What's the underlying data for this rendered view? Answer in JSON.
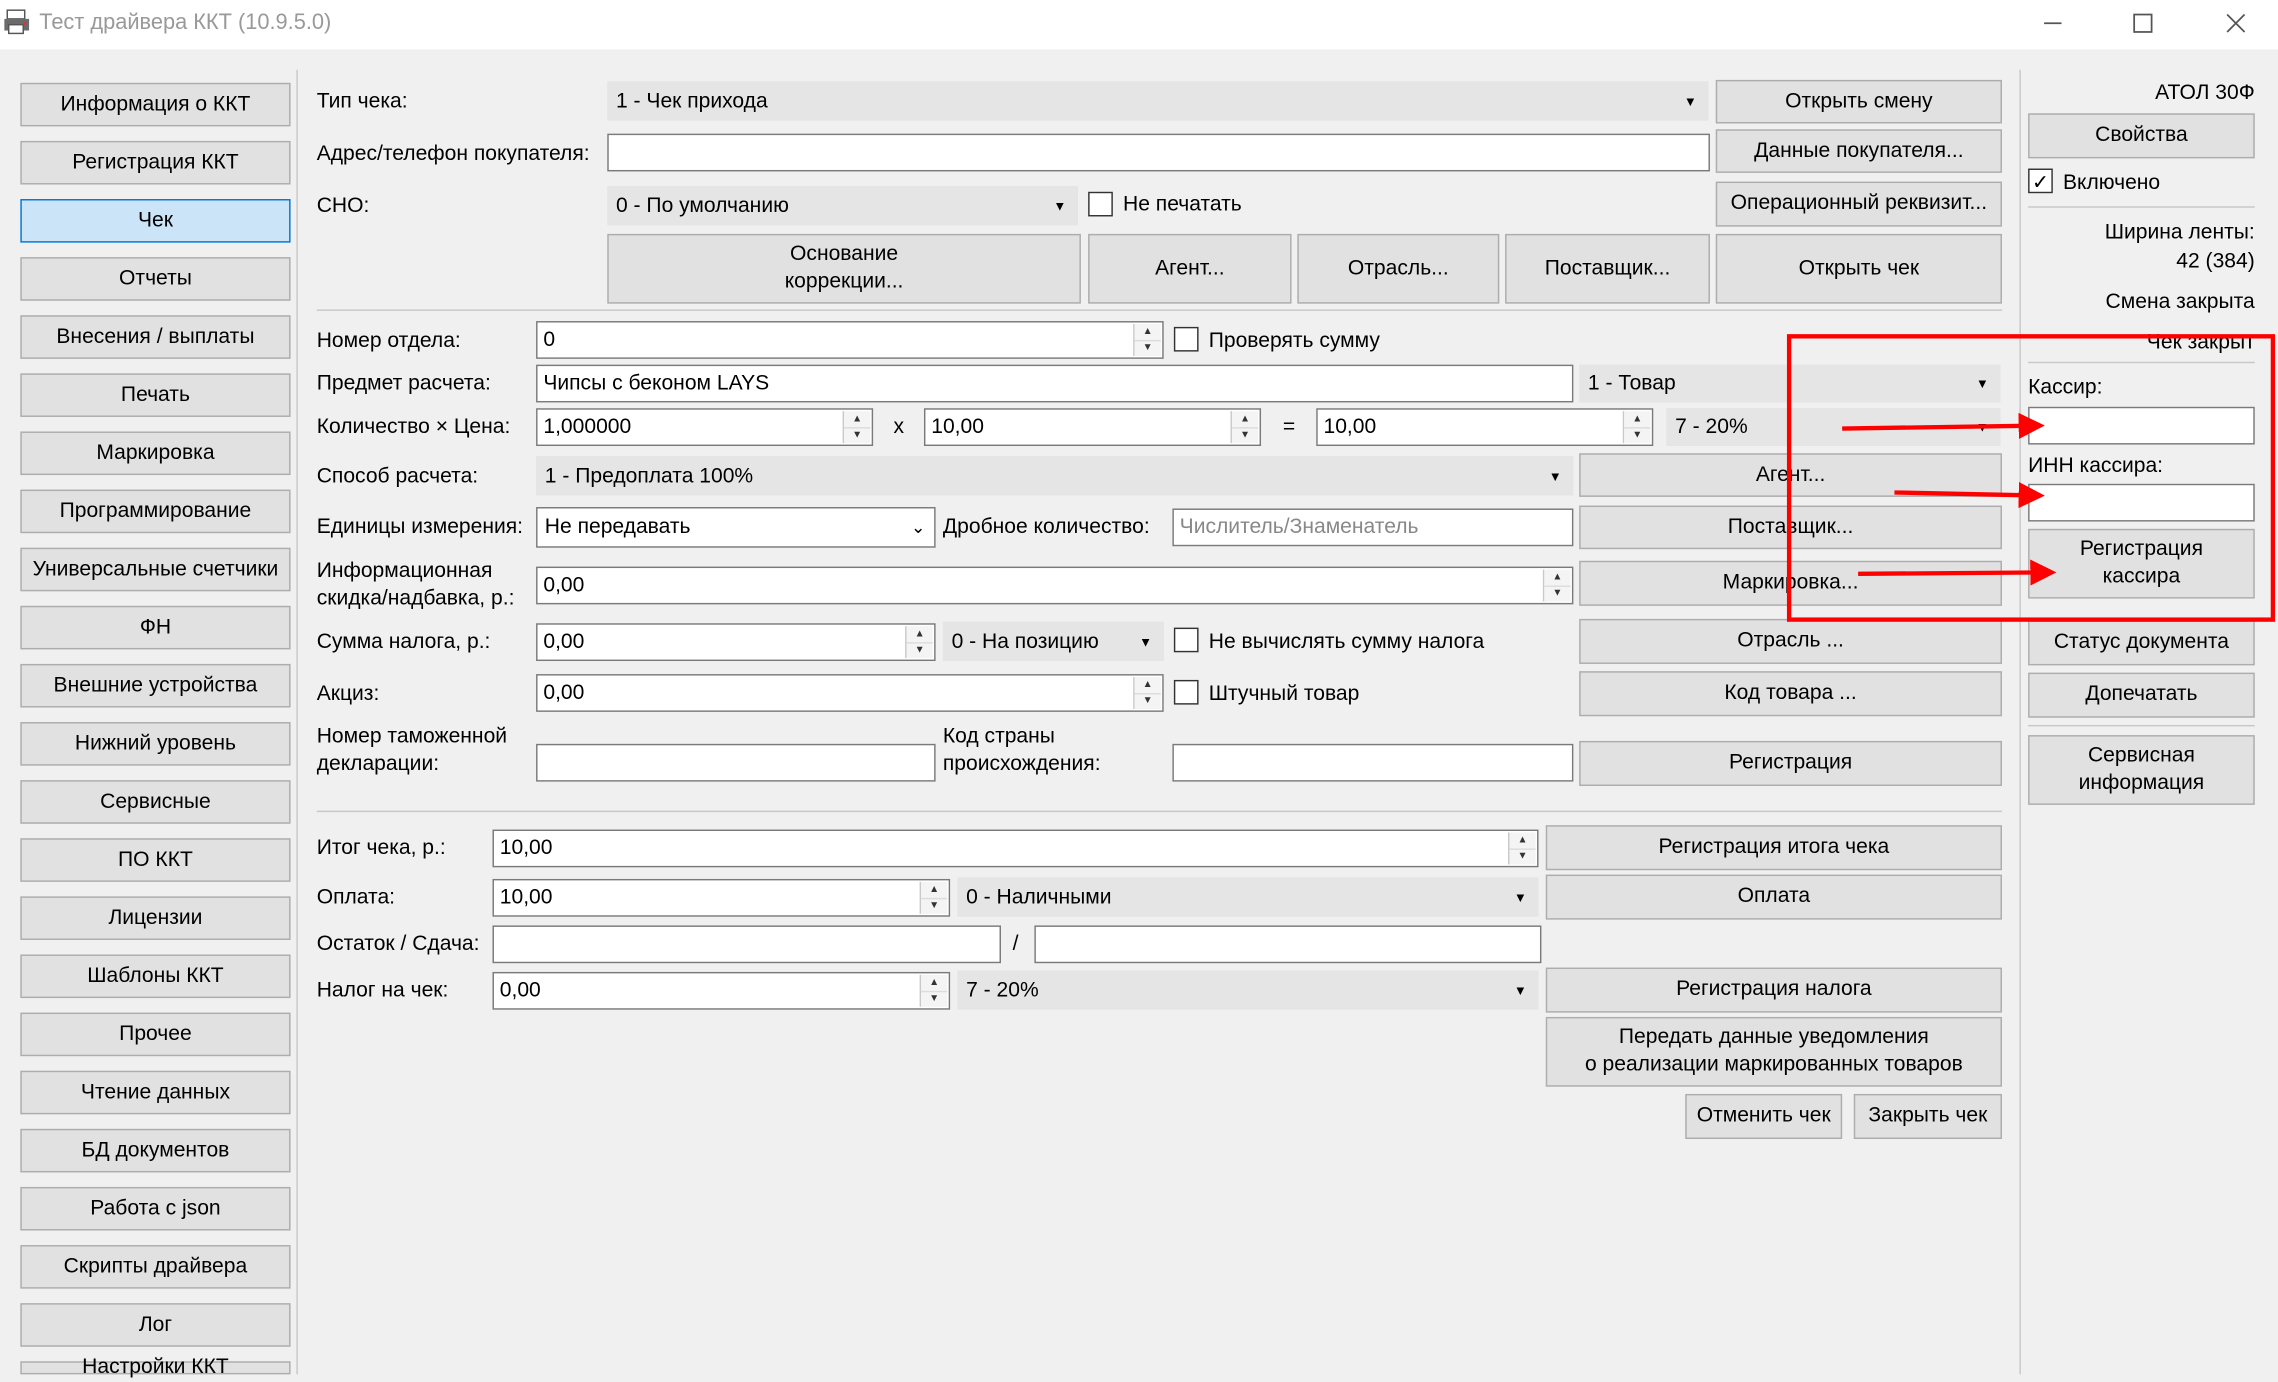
{
  "window": {
    "title": "Тест драйвера ККТ (10.9.5.0)",
    "minimize": "—",
    "maximize": "☐",
    "close": "✕"
  },
  "nav": [
    "Информация о ККТ",
    "Регистрация ККТ",
    "Чек",
    "Отчеты",
    "Внесения / выплаты",
    "Печать",
    "Маркировка",
    "Программирование",
    "Универсальные счетчики",
    "ФН",
    "Внешние устройства",
    "Нижний уровень",
    "Сервисные",
    "ПО ККТ",
    "Лицензии",
    "Шаблоны ККТ",
    "Прочее",
    "Чтение данных",
    "БД документов",
    "Работа с json",
    "Скрипты драйвера",
    "Лог",
    "Настройки ККТ"
  ],
  "receipt": {
    "type_label": "Тип чека:",
    "type_value": "1 - Чек прихода",
    "address_label": "Адрес/телефон покупателя:",
    "address_value": "",
    "sno_label": "СНО:",
    "sno_value": "0 - По умолчанию",
    "no_print_label": "Не печатать",
    "btn_open_shift": "Открыть смену",
    "btn_buyer_data": "Данные покупателя...",
    "btn_operational": "Операционный реквизит...",
    "btn_correction": "Основание\nкоррекции...",
    "btn_agent": "Агент...",
    "btn_industry": "Отрасль...",
    "btn_supplier": "Поставщик...",
    "btn_open_receipt": "Открыть чек"
  },
  "position": {
    "department_label": "Номер отдела:",
    "department_value": "0",
    "check_sum_label": "Проверять сумму",
    "subject_label": "Предмет расчета:",
    "subject_value": "Чипсы с беконом LAYS",
    "subject_type": "1 - Товар",
    "qty_price_label": "Количество × Цена:",
    "qty_value": "1,000000",
    "times": "x",
    "price_value": "10,00",
    "equals": "=",
    "sum_value": "10,00",
    "tax_value": "7 - 20%",
    "method_label": "Способ расчета:",
    "method_value": "1 - Предоплата 100%",
    "btn_agent": "Агент...",
    "units_label": "Единицы измерения:",
    "units_value": "Не передавать",
    "fraction_label": "Дробное количество:",
    "fraction_placeholder": "Числитель/Знаменатель",
    "btn_supplier": "Поставщик...",
    "info_discount_label": "Информационная\nскидка/надбавка, р.:",
    "info_discount_value": "0,00",
    "btn_marking": "Маркировка...",
    "tax_sum_label": "Сумма налога, р.:",
    "tax_sum_value": "0,00",
    "tax_mode_value": "0 - На позицию",
    "no_calc_tax_label": "Не вычислять сумму налога",
    "btn_industry": "Отрасль ...",
    "excise_label": "Акциз:",
    "excise_value": "0,00",
    "piece_goods_label": "Штучный товар",
    "btn_product_code": "Код товара ...",
    "customs_label": "Номер таможенной\nдекларации:",
    "customs_value": "",
    "country_label": "Код страны\nпроисхождения:",
    "country_value": "",
    "btn_register": "Регистрация"
  },
  "totals": {
    "total_label": "Итог чека, р.:",
    "total_value": "10,00",
    "btn_register_total": "Регистрация итога чека",
    "payment_label": "Оплата:",
    "payment_value": "10,00",
    "payment_type": "0 - Наличными",
    "btn_payment": "Оплата",
    "change_label": "Остаток / Сдача:",
    "remainder_value": "",
    "slash": "/",
    "change_value": "",
    "receipt_tax_label": "Налог на чек:",
    "receipt_tax_value": "0,00",
    "receipt_tax_type": "7 - 20%",
    "btn_register_tax": "Регистрация налога",
    "btn_notification": "Передать данные уведомления\nо реализации маркированных товаров",
    "btn_cancel": "Отменить чек",
    "btn_close": "Закрыть чек"
  },
  "device": {
    "model": "АТОЛ 30Ф",
    "btn_properties": "Свойства",
    "enabled_label": "Включено",
    "tape_width_label": "Ширина ленты:",
    "tape_width_value": "42 (384)",
    "shift_status": "Смена закрыта",
    "receipt_status": "Чек закрыт",
    "cashier_label": "Кассир:",
    "cashier_value": "",
    "cashier_inn_label": "ИНН кассира:",
    "cashier_inn_value": "",
    "btn_register_cashier": "Регистрация\nкассира",
    "btn_doc_status": "Статус документа",
    "btn_reprint": "Допечатать",
    "btn_service_info": "Сервисная\nинформация"
  },
  "annotation": {
    "color": "#ff0000"
  }
}
